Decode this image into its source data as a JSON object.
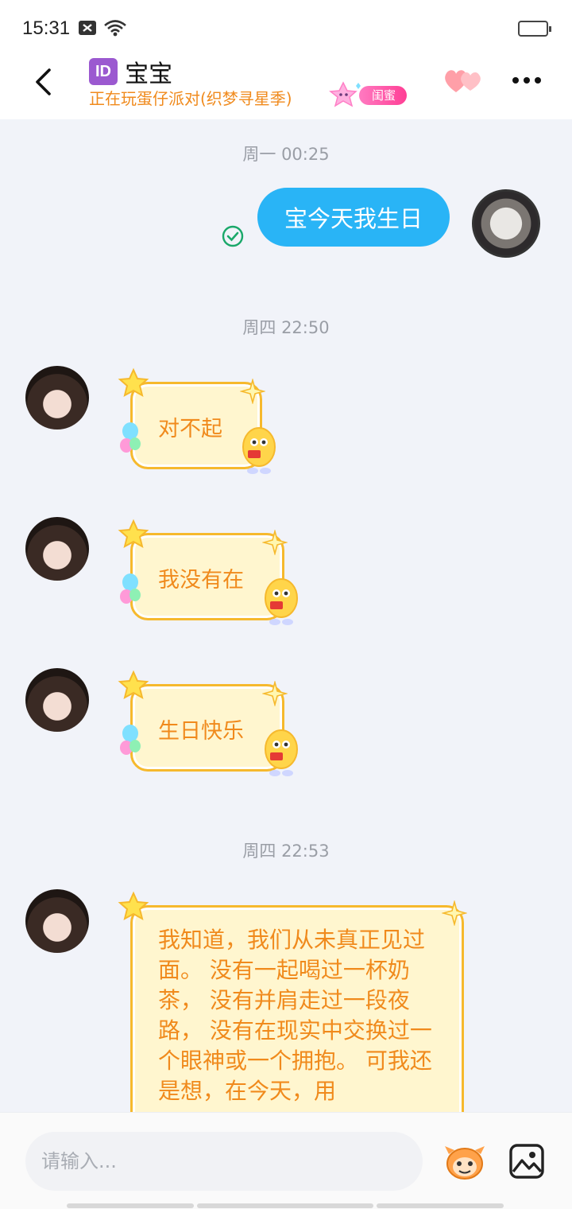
{
  "status_bar": {
    "time": "15:31"
  },
  "header": {
    "id_badge": "ID",
    "title": "宝宝",
    "subtitle": "正在玩蛋仔派对(织梦寻星季)",
    "tag": "闺蜜"
  },
  "chat": {
    "time_1": "周一 00:25",
    "my_message": "宝今天我生日",
    "time_2": "周四 22:50",
    "msg_1": "对不起",
    "msg_2": "我没有在",
    "msg_3": "生日快乐",
    "time_3": "周四 22:53",
    "msg_4": "我知道，我们从未真正见过面。\n没有一起喝过一杯奶茶，\n没有并肩走过一段夜路，\n没有在现实中交换过一个眼神或一个拥抱。\n可我还是想，在今天，用"
  },
  "input": {
    "placeholder": "请输入..."
  },
  "colors": {
    "accent_blue": "#29b4f6",
    "bubble_orange": "#f08a1c",
    "bubble_fill": "#fff6cf"
  }
}
